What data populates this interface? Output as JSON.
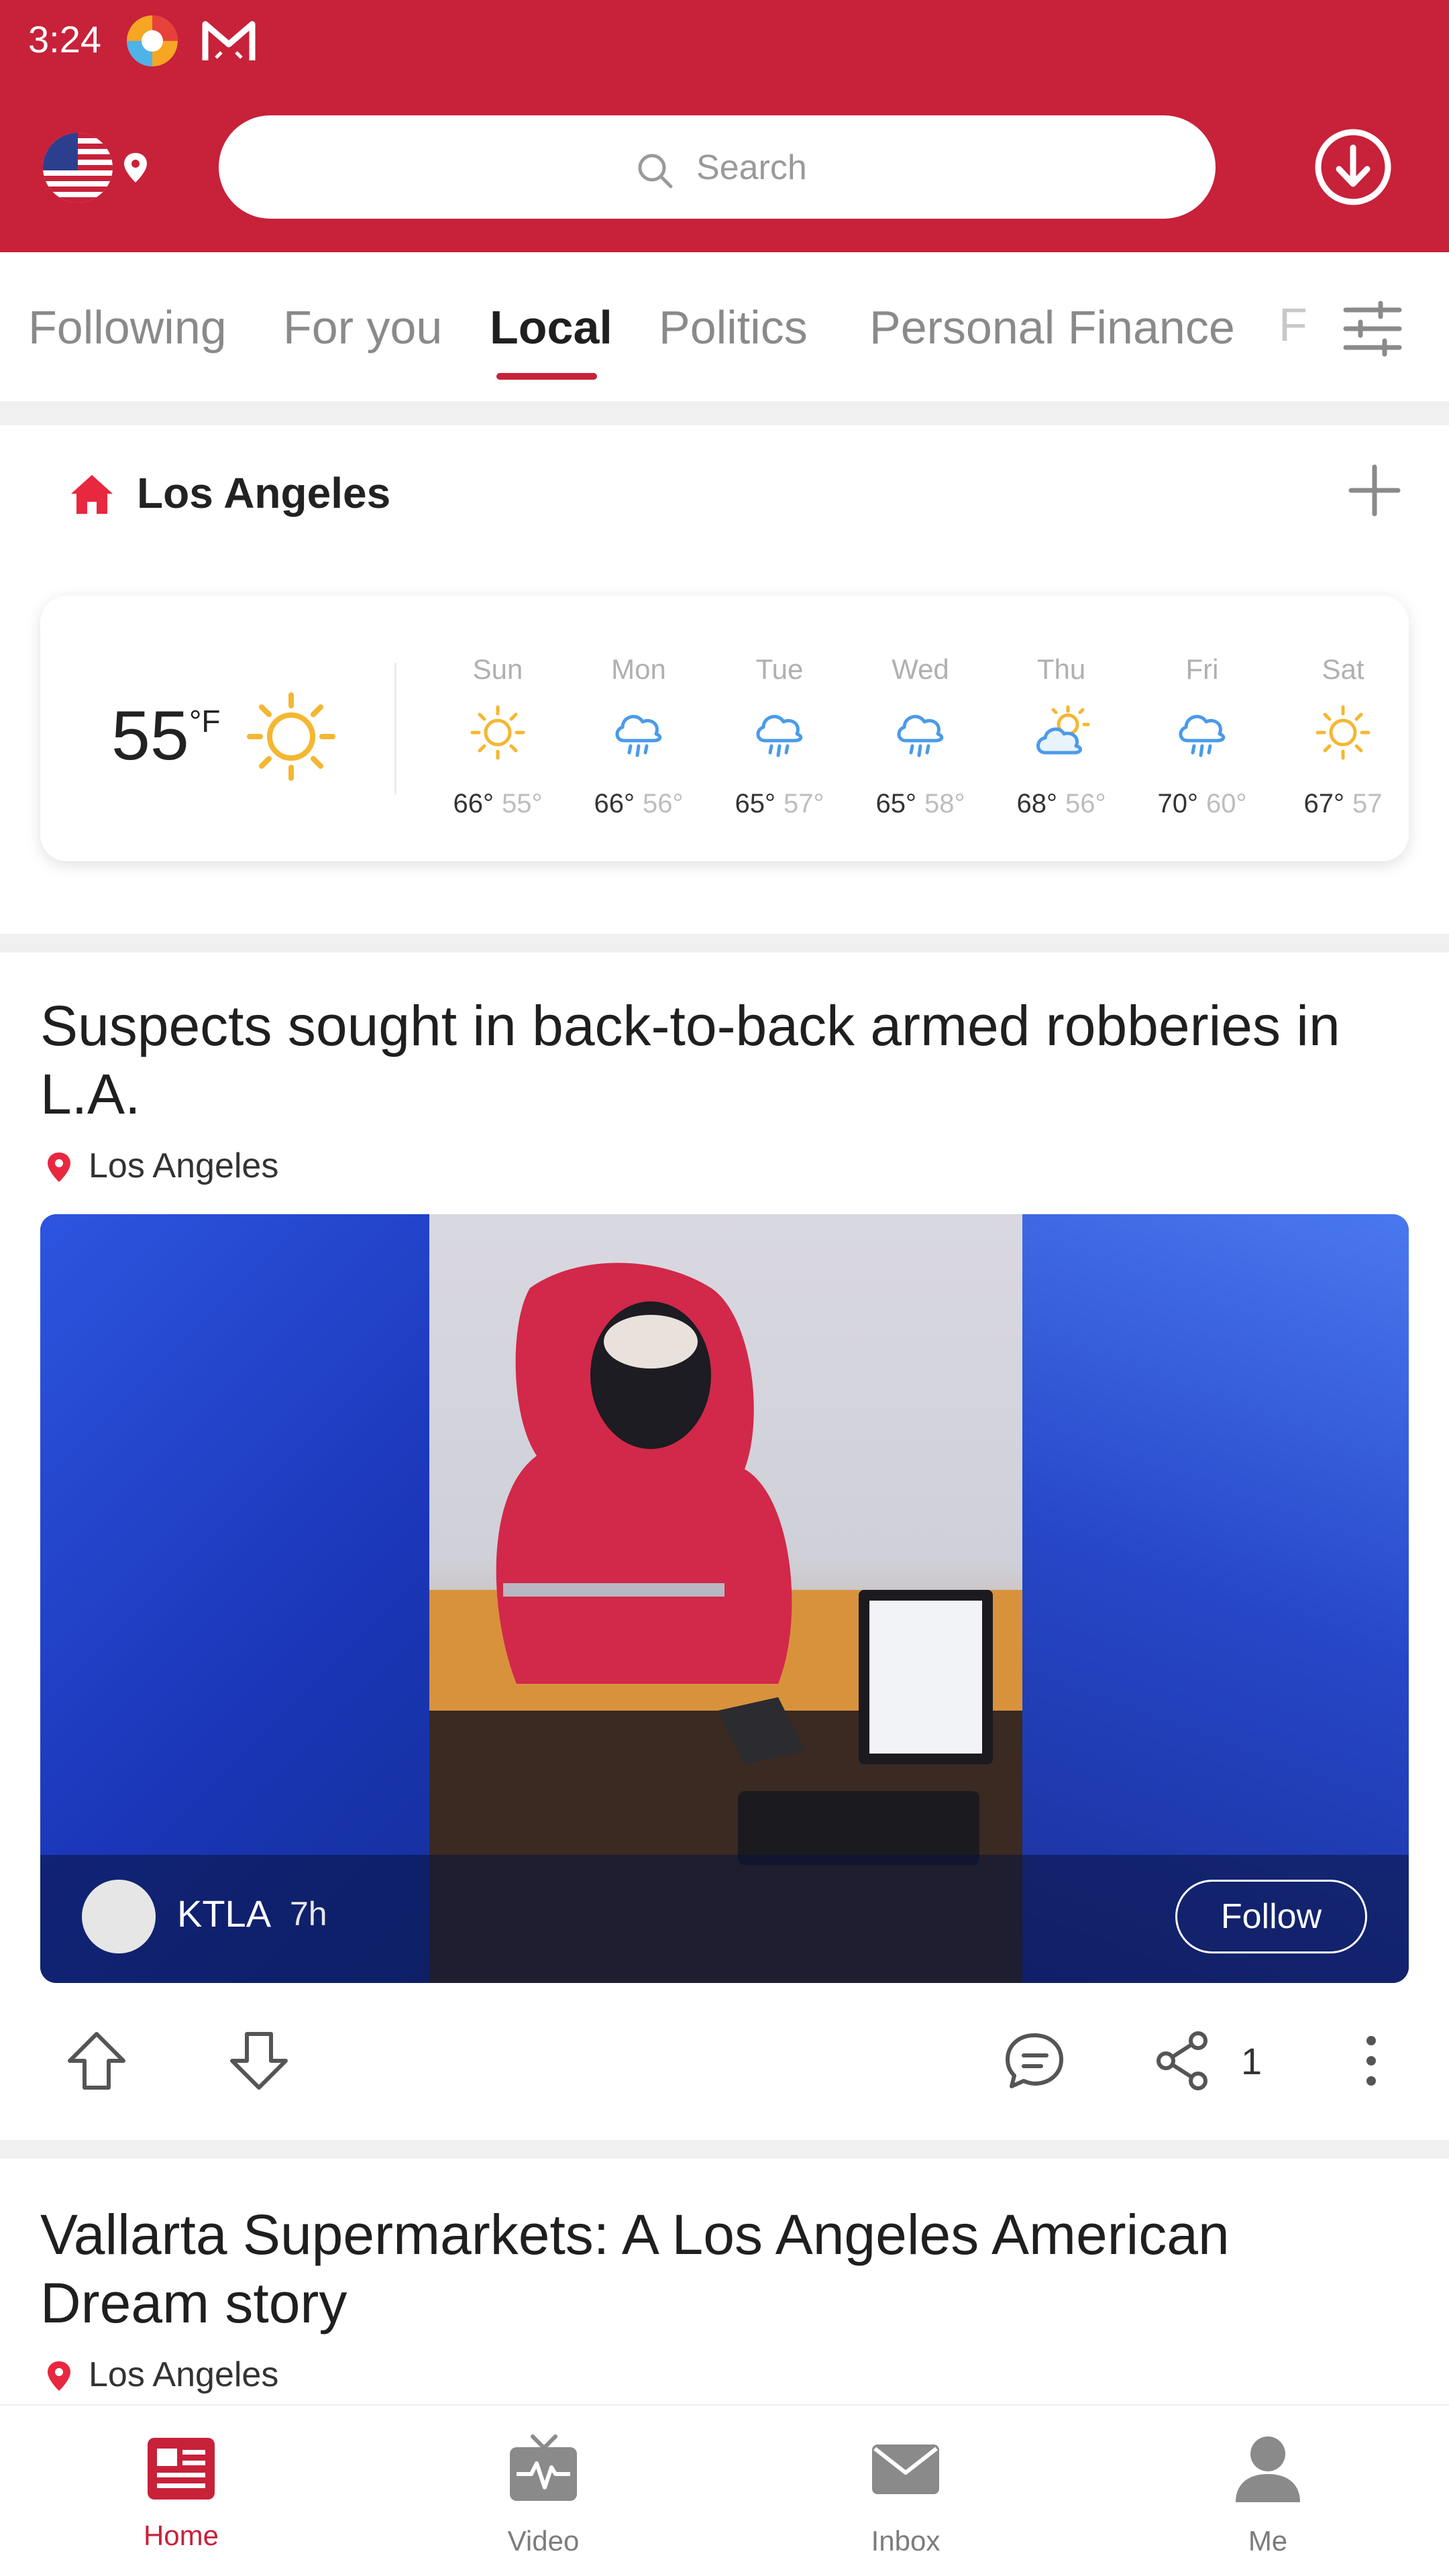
{
  "status_bar": {
    "time": "3:24"
  },
  "header": {
    "search_placeholder": "Search",
    "brand_color": "#c8213a",
    "icons": [
      "us-flag-icon",
      "location-pin-icon",
      "search-icon",
      "download-icon"
    ]
  },
  "tabs": {
    "items": [
      "Following",
      "For you",
      "Local",
      "Politics",
      "Personal Finance"
    ],
    "active": "Local",
    "overflow_hint": "F"
  },
  "local": {
    "city": "Los Angeles",
    "current": {
      "temp": "55",
      "unit": "°F",
      "icon": "sun-icon"
    },
    "forecast": [
      {
        "day": "Sun",
        "hi": "66°",
        "lo": "55°",
        "icon": "sun-icon"
      },
      {
        "day": "Mon",
        "hi": "66°",
        "lo": "56°",
        "icon": "rain-icon"
      },
      {
        "day": "Tue",
        "hi": "65°",
        "lo": "57°",
        "icon": "rain-icon"
      },
      {
        "day": "Wed",
        "hi": "65°",
        "lo": "58°",
        "icon": "rain-icon"
      },
      {
        "day": "Thu",
        "hi": "68°",
        "lo": "56°",
        "icon": "partly-cloudy-icon"
      },
      {
        "day": "Fri",
        "hi": "70°",
        "lo": "60°",
        "icon": "rain-icon"
      },
      {
        "day": "Sat",
        "hi": "67°",
        "lo": "57",
        "icon": "sun-icon"
      }
    ]
  },
  "articles": [
    {
      "title": "Suspects sought in back-to-back armed robberies in L.A.",
      "location": "Los Angeles",
      "source": "KTLA",
      "time": "7h",
      "follow_label": "Follow",
      "share_count": "1"
    },
    {
      "title": "Vallarta Supermarkets: A Los Angeles American Dream story",
      "location": "Los Angeles"
    }
  ],
  "bottom_nav": [
    {
      "label": "Home",
      "icon": "newspaper-icon",
      "active": true
    },
    {
      "label": "Video",
      "icon": "tv-icon",
      "active": false
    },
    {
      "label": "Inbox",
      "icon": "envelope-icon",
      "active": false
    },
    {
      "label": "Me",
      "icon": "person-icon",
      "active": false
    }
  ]
}
